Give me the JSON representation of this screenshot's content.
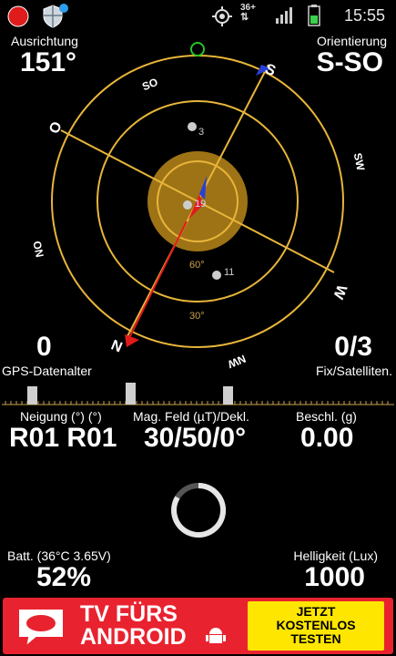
{
  "status_bar": {
    "time": "15:55",
    "network_label_top": "36+",
    "icons": [
      "record-icon",
      "shield-icon",
      "gps-icon",
      "network-arrows-icon",
      "signal-icon",
      "battery-icon"
    ]
  },
  "compass": {
    "left_label": "Ausrichtung",
    "left_value": "151°",
    "right_label": "Orientierung",
    "right_value": "S-SO",
    "dial_labels": [
      "SO",
      "S",
      "SW",
      "W",
      "NW",
      "N",
      "NO",
      "O"
    ],
    "ring_labels": [
      "60°",
      "30°"
    ],
    "satellites": [
      "3",
      "19",
      "11"
    ]
  },
  "gps": {
    "age_value": "0",
    "age_label": "GPS-Datenalter",
    "fix_value": "0/3",
    "fix_label": "Fix/Satelliten."
  },
  "sensors": {
    "tilt_label": "Neigung (°) (°)",
    "tilt_value": "R01 R01",
    "mag_label": "Mag. Feld (µT)/Dekl.",
    "mag_value": "30/50/0°",
    "accel_label": "Beschl. (g)",
    "accel_value": "0.00"
  },
  "bottom": {
    "battery_label": "Batt. (36°C 3.65V)",
    "battery_value": "52%",
    "brightness_label": "Helligkeit (Lux)",
    "brightness_value": "1000"
  },
  "ad": {
    "line1": "TV FÜRS",
    "line2": "ANDROID",
    "cta_line1": "JETZT",
    "cta_line2": "KOSTENLOS",
    "cta_line3": "TESTEN"
  },
  "colors": {
    "ring": "#e8b53a",
    "center_fill": "#b8871a",
    "arrow_blue": "#2b3fd6",
    "arrow_red": "#e01b1b",
    "green_marker": "#27c427",
    "ad_red": "#e8232f",
    "ad_yellow": "#ffe600"
  }
}
